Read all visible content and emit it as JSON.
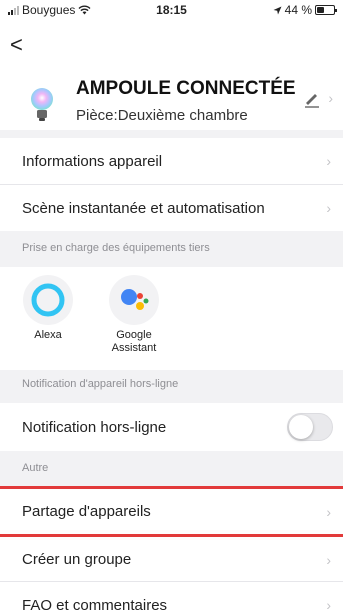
{
  "status_bar": {
    "carrier": "Bouygues",
    "time": "18:15",
    "location_arrow": "location-arrow-icon",
    "battery": "44 %",
    "battery_level": 0.44
  },
  "header": {
    "device_name": "AMPOULE CONNECTÉE",
    "room": "Pièce:Deuxième chambre"
  },
  "rows": {
    "info": "Informations appareil",
    "scene": "Scène instantanée et automatisation",
    "offline_notif": "Notification hors-ligne",
    "share": "Partage d'appareils",
    "group": "Créer un groupe",
    "faq": "FAQ et commentaires"
  },
  "sections": {
    "third_party": "Prise en charge des équipements tiers",
    "offline": "Notification d'appareil hors-ligne",
    "other": "Autre"
  },
  "third_party": [
    {
      "name": "Alexa",
      "icon": "alexa-icon"
    },
    {
      "name": "Google\nAssistant",
      "icon": "google-assistant-icon"
    }
  ],
  "toggles": {
    "offline_notification": false
  },
  "colors": {
    "alexa": "#31c4f3",
    "google_blue": "#4285f4",
    "google_red": "#ea4335",
    "google_yellow": "#fbbc05",
    "google_green": "#34a853",
    "highlight": "#e23a3a"
  }
}
